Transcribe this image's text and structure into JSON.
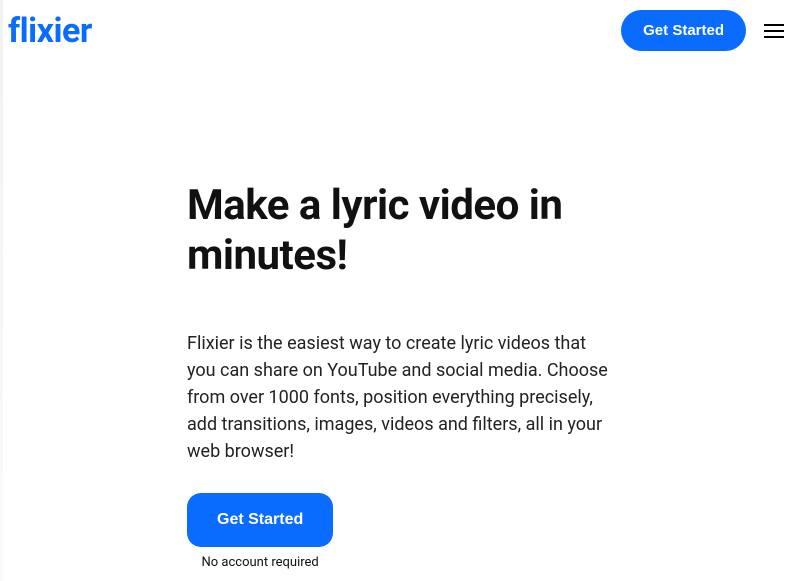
{
  "header": {
    "logo": "flixier",
    "cta_label": "Get Started"
  },
  "hero": {
    "heading": "Make a lyric video in minutes!",
    "description": "Flixier is the easiest way to create lyric videos that you can share on YouTube and social media. Choose from over 1000 fonts, position everything precisely, add transitions, images, videos and filters, all in your web browser!",
    "cta_label": "Get Started",
    "cta_subtext": "No account required"
  }
}
